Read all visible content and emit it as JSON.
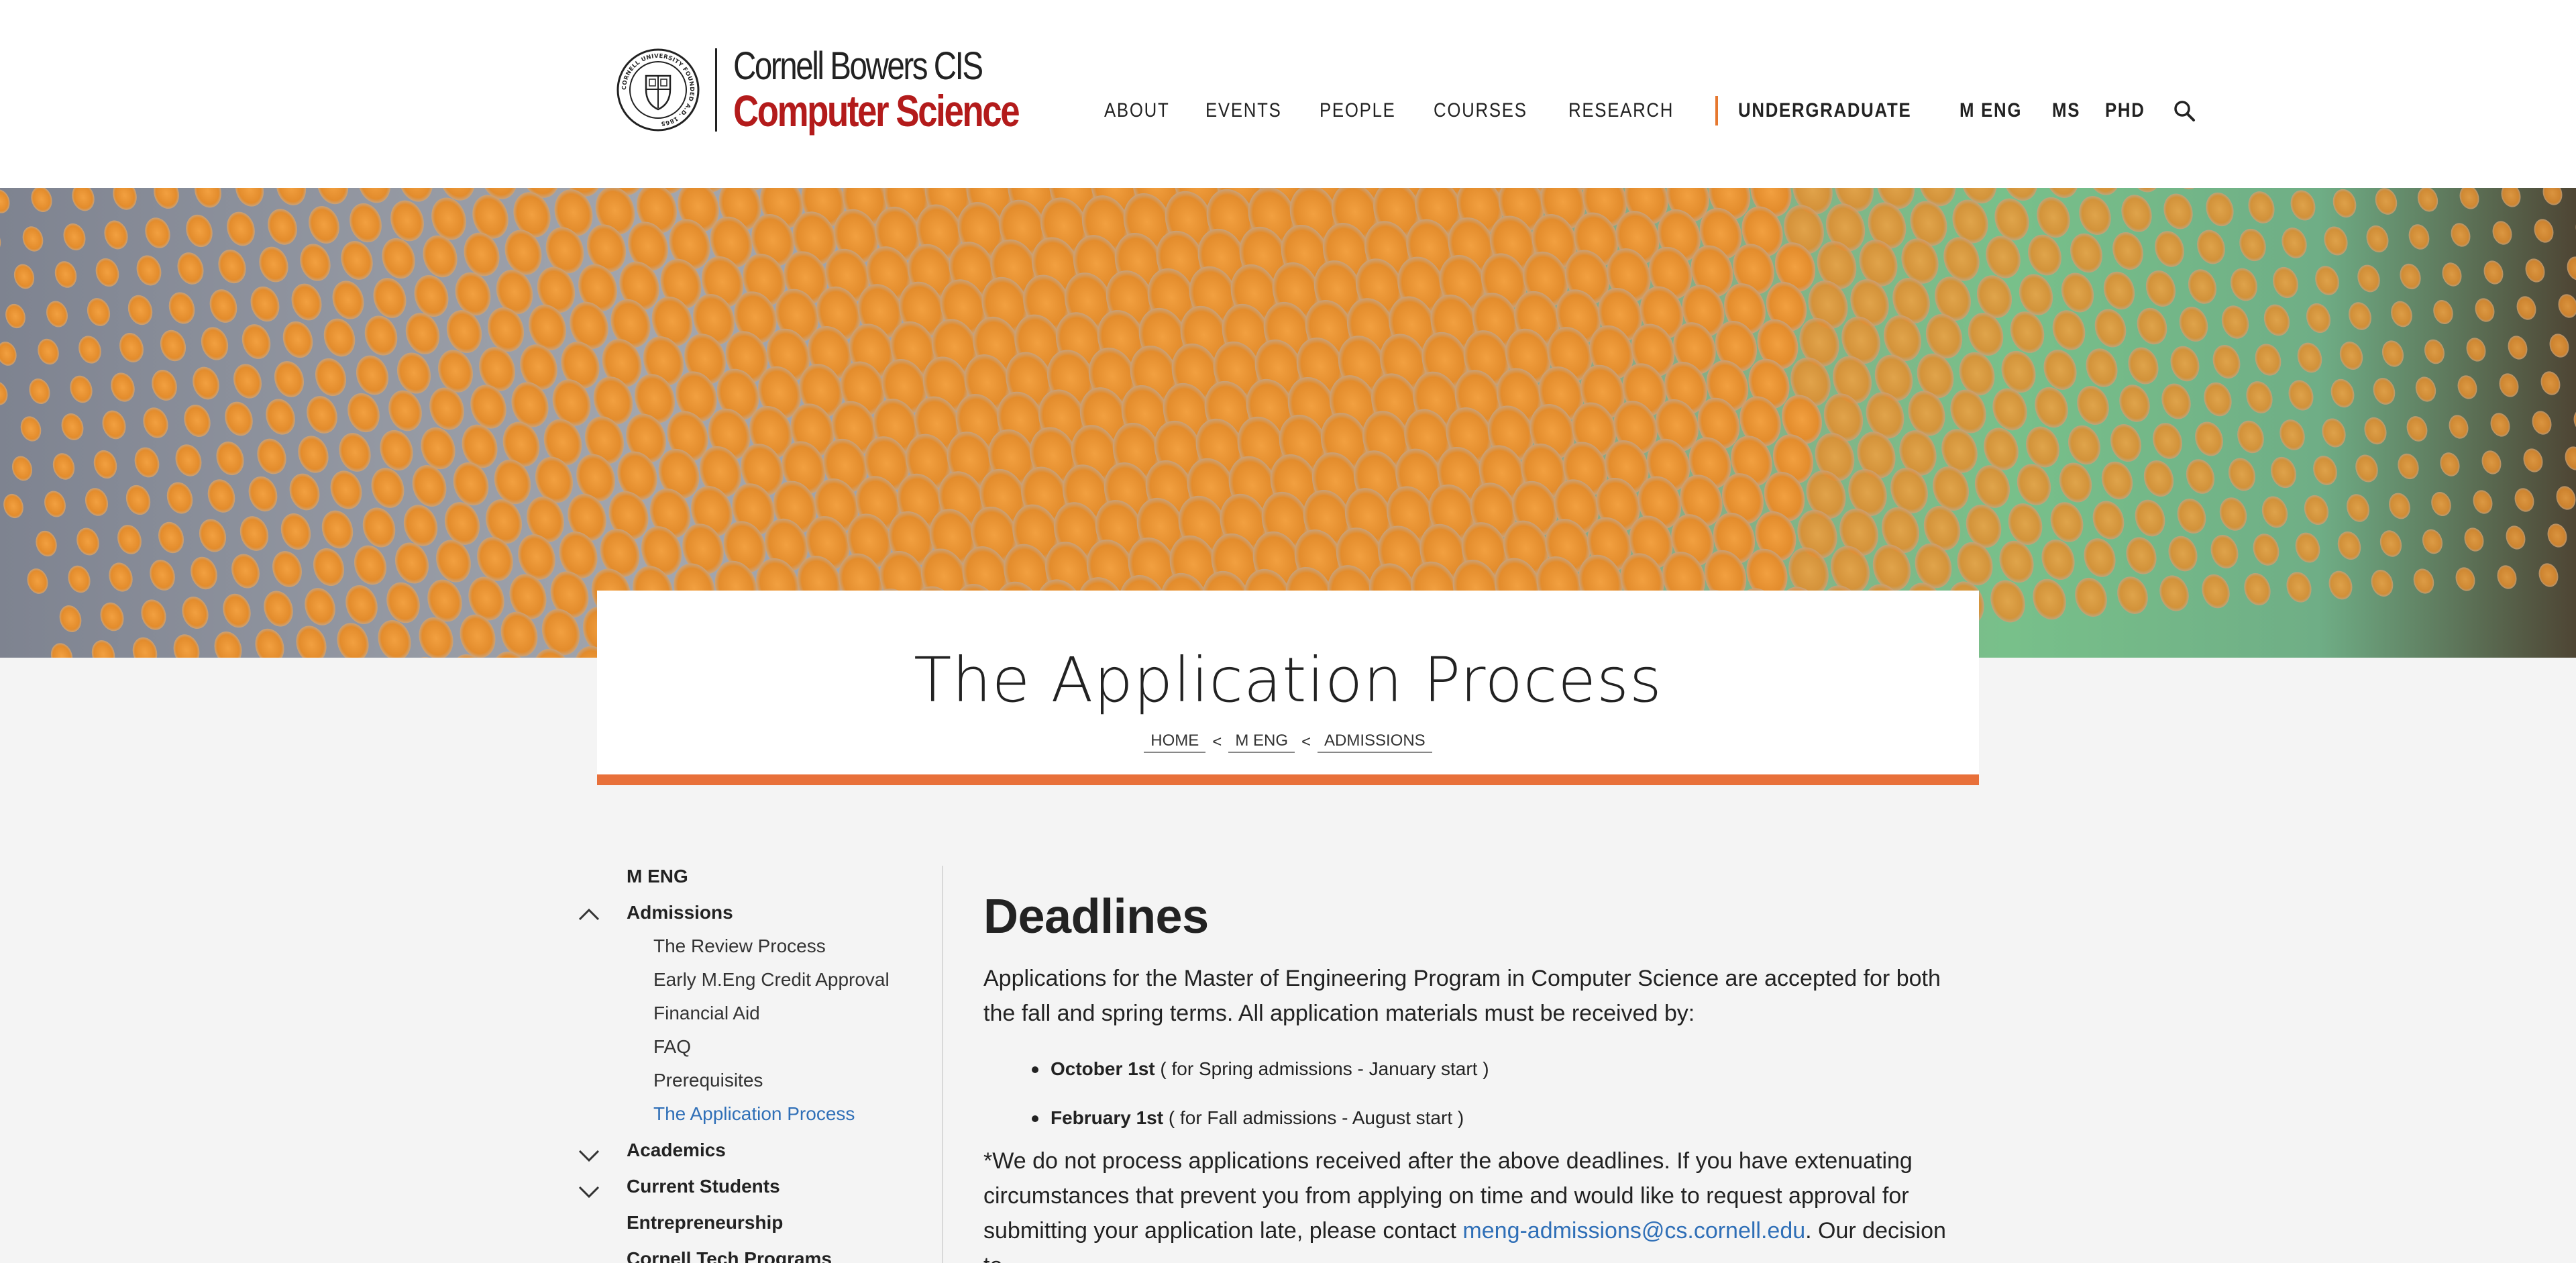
{
  "header": {
    "logo": {
      "line1": "Cornell Bowers CIS",
      "line2": "Computer Science",
      "seal_text": "CORNELL UNIVERSITY FOUNDED A.D. 1865"
    },
    "nav": [
      {
        "label": "ABOUT"
      },
      {
        "label": "EVENTS"
      },
      {
        "label": "PEOPLE"
      },
      {
        "label": "COURSES"
      },
      {
        "label": "RESEARCH"
      }
    ],
    "programs": [
      {
        "label": "UNDERGRADUATE"
      },
      {
        "label": "M ENG"
      },
      {
        "label": "MS"
      },
      {
        "label": "PHD"
      }
    ],
    "search_icon": "search-icon"
  },
  "hero": {
    "image": "orange-dot-pattern-photo"
  },
  "title_card": {
    "title": "The Application Process",
    "breadcrumb": [
      "HOME",
      "M ENG",
      "ADMISSIONS"
    ],
    "breadcrumb_separator": "<",
    "accent_color": "#e8703a"
  },
  "sidebar": {
    "top": "M ENG",
    "sections": [
      {
        "label": "Admissions",
        "expanded": true
      },
      {
        "label": "Academics",
        "expanded": false
      },
      {
        "label": "Current Students",
        "expanded": false
      },
      {
        "label": "Entrepreneurship"
      },
      {
        "label": "Cornell Tech Programs"
      }
    ],
    "admissions_items": [
      "The Review Process",
      "Early M.Eng Credit Approval",
      "Financial Aid",
      "FAQ",
      "Prerequisites",
      "The Application Process"
    ],
    "active_item": "The Application Process",
    "active_color": "#2f6fb7"
  },
  "content": {
    "heading": "Deadlines",
    "intro": "Applications for the Master of Engineering Program in Computer Science are accepted for both the fall and spring terms. All application materials must be received by:",
    "deadlines": [
      {
        "date": "October 1st",
        "detail": " ( for Spring admissions - January start )"
      },
      {
        "date": "February 1st",
        "detail": " ( for Fall admissions - August start )"
      }
    ],
    "note_before_link": "*We do not process applications received after the above deadlines. If you have extenuating circumstances that prevent you from applying on time and would like to request approval for submitting your application late, please contact ",
    "email": "meng-admissions@cs.cornell.edu",
    "note_after_link": ". Our decision to"
  }
}
